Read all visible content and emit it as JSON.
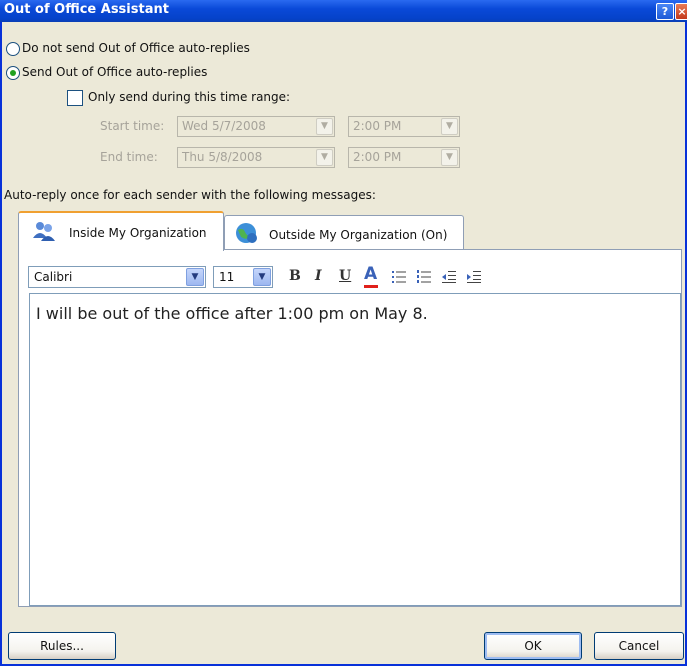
{
  "window": {
    "title": "Out of Office Assistant",
    "help_glyph": "?",
    "close_glyph": "×"
  },
  "options": {
    "no_send_label": "Do not send Out of Office auto-replies",
    "send_label": "Send Out of Office auto-replies",
    "selected": "send",
    "time_range_label": "Only send during this time range:",
    "time_range_checked": false,
    "start_label": "Start time:",
    "start_date": "Wed 5/7/2008",
    "start_time": "2:00 PM",
    "end_label": "End time:",
    "end_date": "Thu 5/8/2008",
    "end_time": "2:00 PM"
  },
  "autoreply_heading": "Auto-reply once for each sender with the following messages:",
  "tabs": [
    {
      "label": "Inside My Organization",
      "active": true,
      "icon": "people-icon"
    },
    {
      "label": "Outside My Organization (On)",
      "active": false,
      "icon": "globe-icon"
    }
  ],
  "format": {
    "font": "Calibri",
    "size": "11",
    "bold": "B",
    "italic": "I",
    "underline": "U",
    "font_color": "A",
    "font_color_hex": "#e0201b"
  },
  "message": "I will be out of the office after 1:00 pm on May 8.",
  "buttons": {
    "rules": "Rules...",
    "ok": "OK",
    "cancel": "Cancel"
  },
  "colors": {
    "titlebar": "#0a49d8",
    "dialog_bg": "#ece9d8",
    "tab_accent": "#f0a030"
  }
}
